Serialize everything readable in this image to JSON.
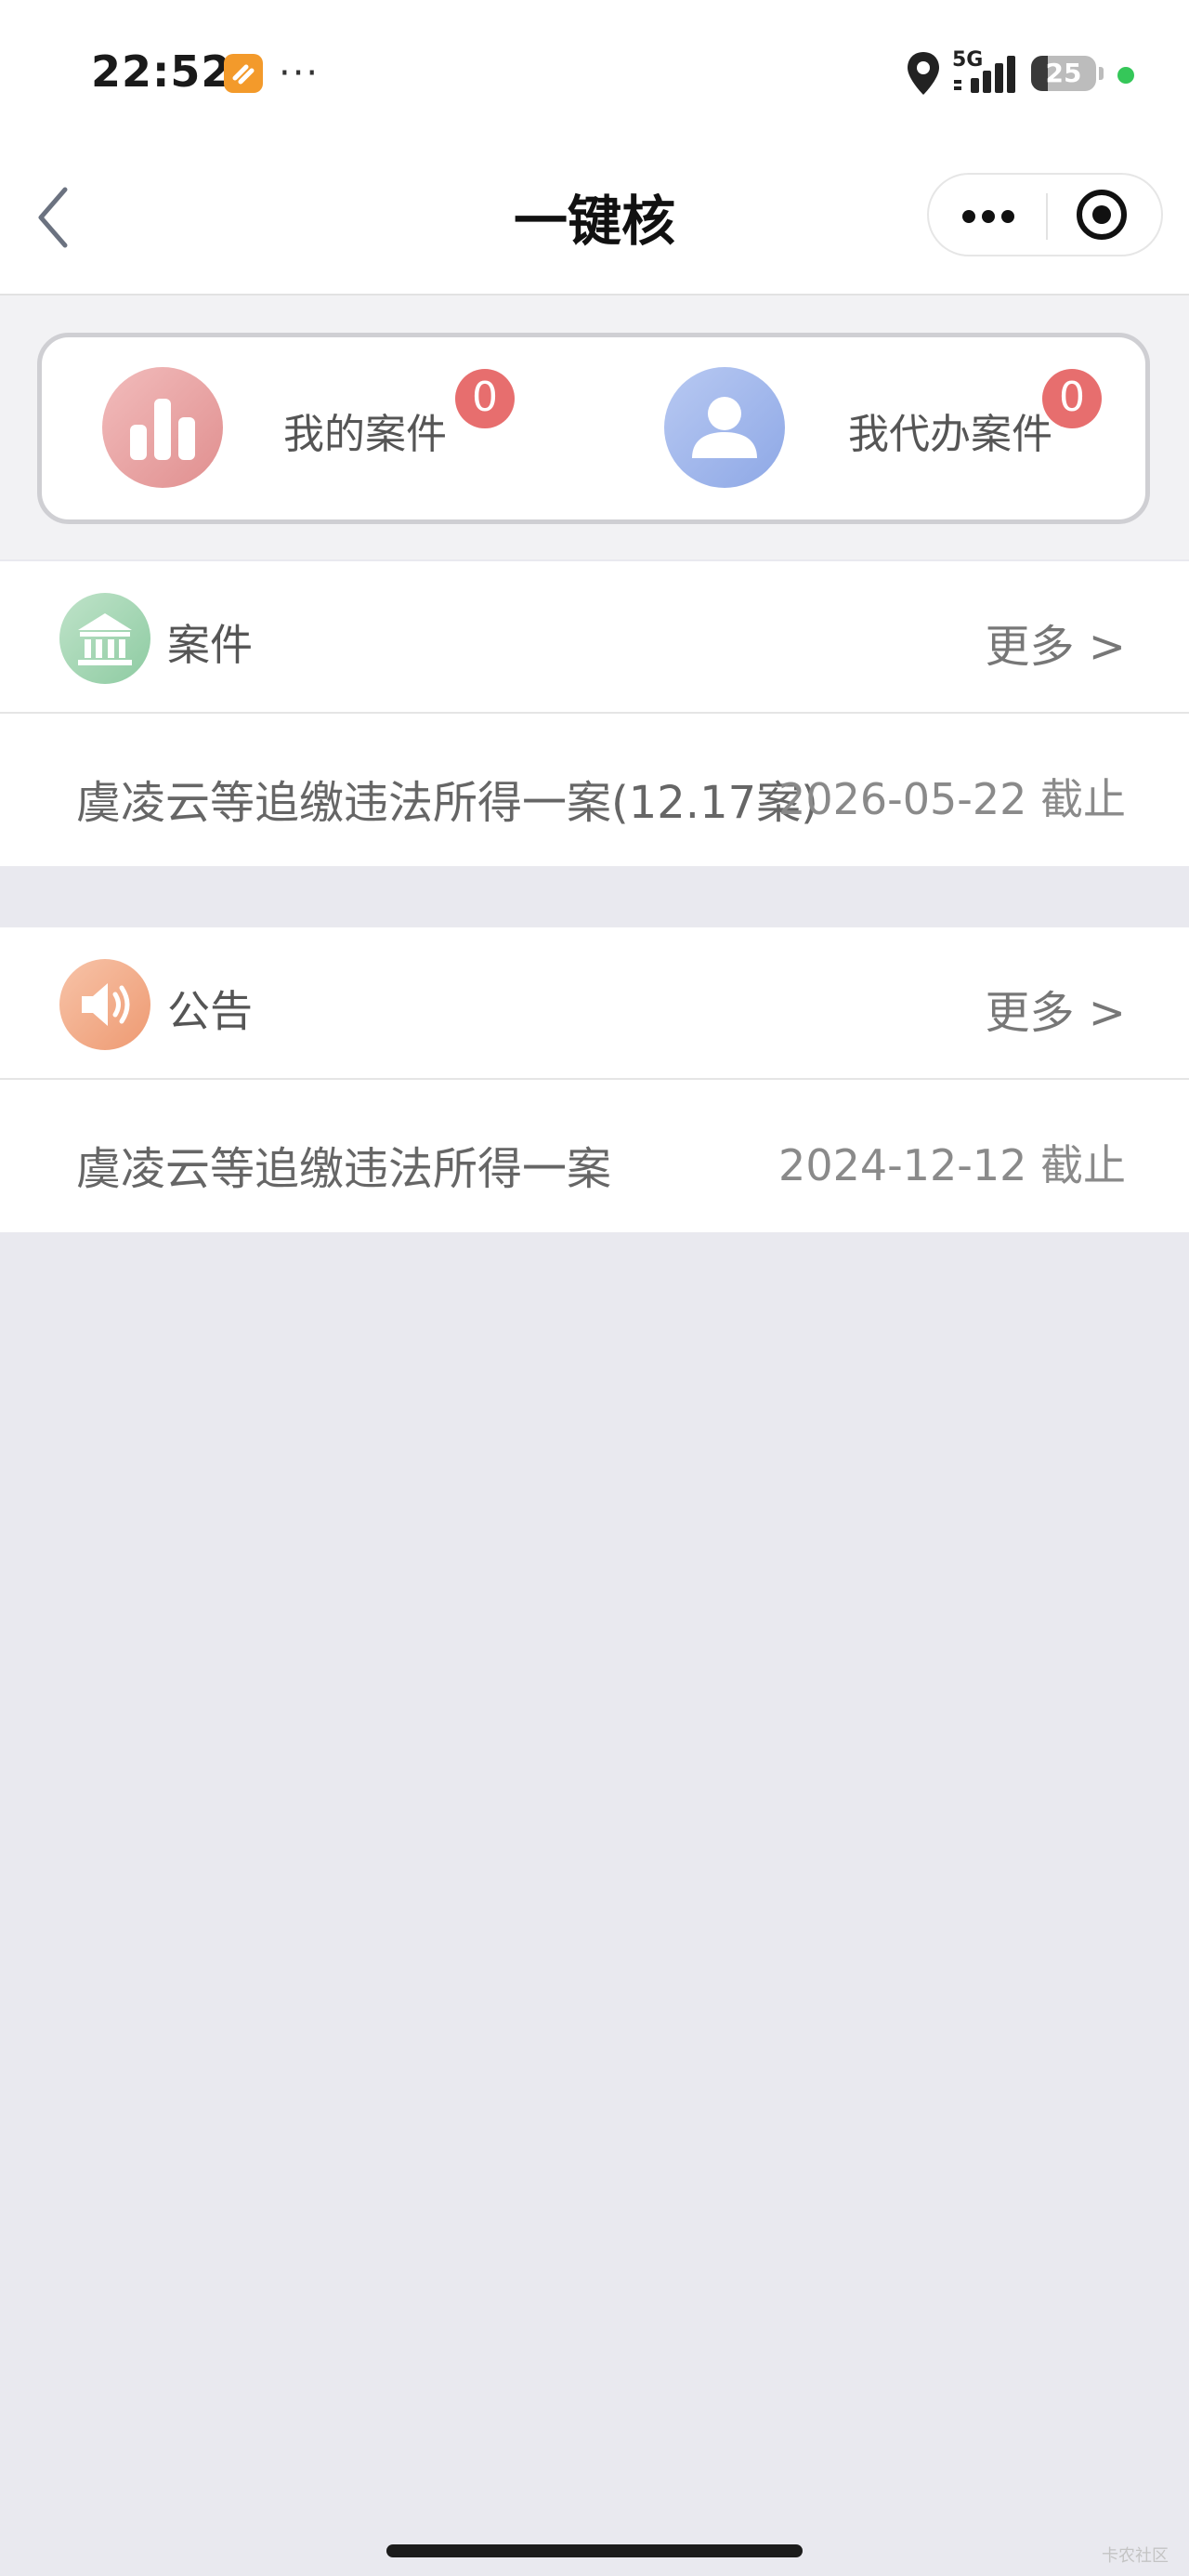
{
  "status_bar": {
    "time": "22:52",
    "dots": "···",
    "network": "5G",
    "battery": "25",
    "battery_level": 0.25,
    "icons": [
      "app-notification-icon",
      "location-icon",
      "signal-icon",
      "battery-icon",
      "privacy-indicator-icon"
    ],
    "accent_green": "#35c759"
  },
  "nav": {
    "title": "一键核",
    "icons": [
      "back-chevron-icon",
      "more-dots-icon",
      "target-icon"
    ]
  },
  "summary": {
    "my_cases": {
      "label": "我的案件",
      "count": "0",
      "icon": "bar-chart-icon",
      "icon_color": "#eaa0a0"
    },
    "agent_cases": {
      "label": "我代办案件",
      "count": "0",
      "icon": "person-icon",
      "icon_color": "#9cb3ea"
    },
    "badge_color": "#e76e6e"
  },
  "cases": {
    "title": "案件",
    "more": "更多 >",
    "icon": "bank-icon",
    "icon_color": "#9fd3b0",
    "items": [
      {
        "title": "虞凌云等追缴违法所得一案(12.17案)",
        "date": "2026-05-22 截止"
      }
    ]
  },
  "notices": {
    "title": "公告",
    "more": "更多 >",
    "icon": "speaker-icon",
    "icon_color": "#f2a27e",
    "items": [
      {
        "title": "虞凌云等追缴违法所得一案",
        "date": "2024-12-12 截止"
      }
    ]
  },
  "watermark": "卡农社区"
}
